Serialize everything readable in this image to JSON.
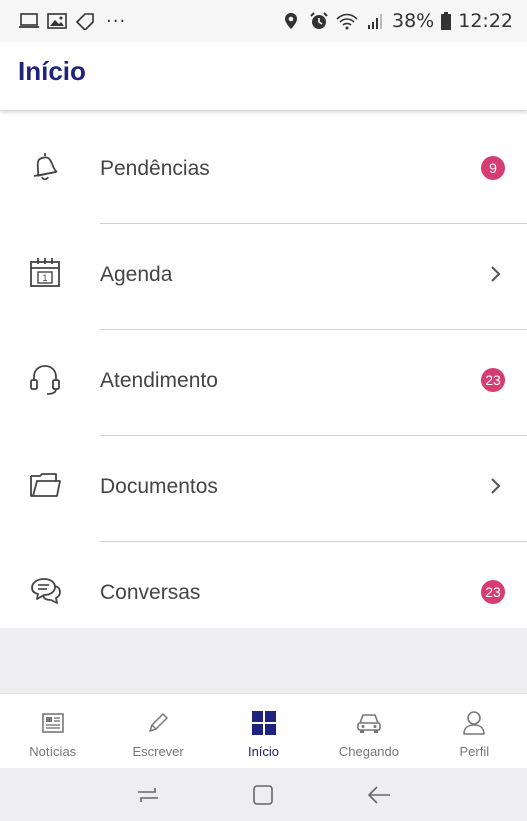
{
  "status_bar": {
    "dots": "···",
    "battery": "38%",
    "time": "12:22"
  },
  "header": {
    "title": "Início"
  },
  "menu": {
    "items": [
      {
        "label": "Pendências",
        "icon": "bell-icon",
        "badge": "9",
        "trailing": "badge"
      },
      {
        "label": "Agenda",
        "icon": "calendar-icon",
        "trailing": "chevron"
      },
      {
        "label": "Atendimento",
        "icon": "headset-icon",
        "badge": "23",
        "trailing": "badge"
      },
      {
        "label": "Documentos",
        "icon": "folder-icon",
        "trailing": "chevron"
      },
      {
        "label": "Conversas",
        "icon": "chat-bubbles-icon",
        "badge": "23",
        "trailing": "badge"
      }
    ]
  },
  "calendar_icon_day": "1",
  "bottom_nav": {
    "items": [
      {
        "label": "Notícias",
        "icon": "newspaper-icon"
      },
      {
        "label": "Escrever",
        "icon": "pencil-icon"
      },
      {
        "label": "Início",
        "icon": "grid-icon",
        "active": true
      },
      {
        "label": "Chegando",
        "icon": "car-icon"
      },
      {
        "label": "Perfil",
        "icon": "person-icon"
      }
    ]
  },
  "colors": {
    "accent": "#1f237d",
    "badge": "#d63e73",
    "text": "#444444",
    "inactive": "#777777"
  }
}
